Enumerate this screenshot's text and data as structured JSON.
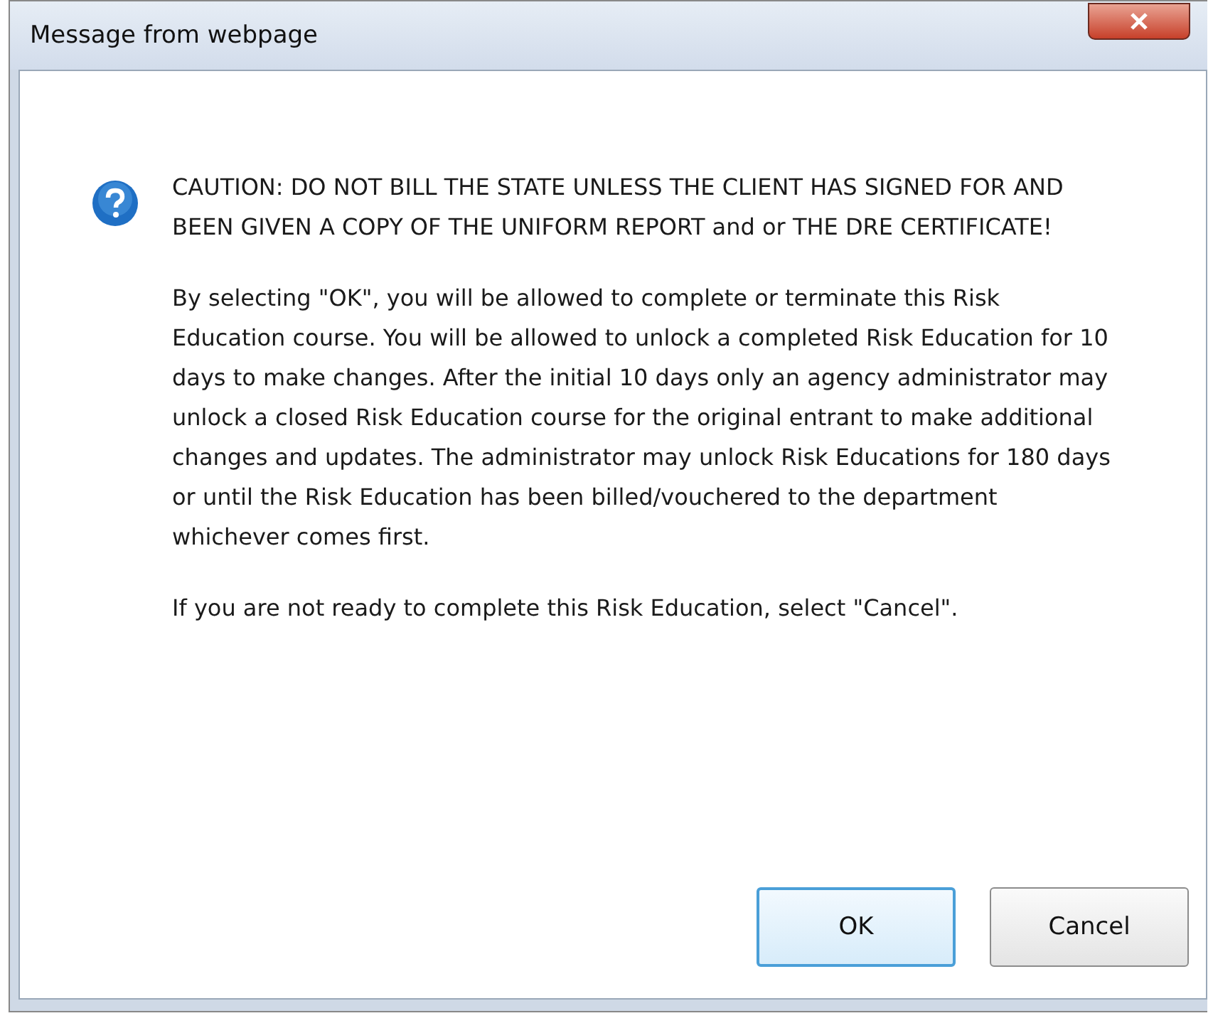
{
  "window": {
    "title": "Message from webpage"
  },
  "message": {
    "paragraphs": [
      "CAUTION: DO NOT BILL THE STATE UNLESS THE CLIENT HAS SIGNED FOR AND BEEN GIVEN A COPY OF THE UNIFORM REPORT and or THE DRE CERTIFICATE!",
      "By selecting \"OK\", you will be allowed to complete or terminate this Risk Education course. You will be allowed to unlock a completed Risk Education for 10 days to make changes. After the initial 10 days only an agency administrator may unlock a closed Risk Education course for the original entrant to make additional changes and updates. The administrator may unlock Risk Educations for 180 days or until the Risk Education has been billed/vouchered to the department whichever comes first.",
      "If you are not ready to complete this Risk Education, select \"Cancel\"."
    ]
  },
  "buttons": [
    {
      "label": "OK",
      "focused": true
    },
    {
      "label": "Cancel",
      "focused": false
    }
  ]
}
